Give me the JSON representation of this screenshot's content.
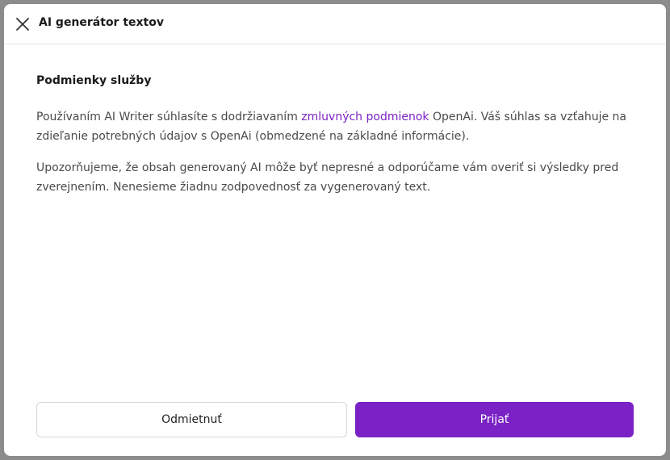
{
  "dialog": {
    "title": "AI generátor textov",
    "close_icon": "close-icon"
  },
  "terms": {
    "heading": "Podmienky služby",
    "paragraph1": {
      "before_link": "Používaním AI Writer súhlasíte s dodržiavaním ",
      "link_text": "zmluvných podmienok",
      "after_link": " OpenAi. Váš súhlas sa vzťahuje na zdieľanie potrebných údajov s OpenAi (obmedzené na základné informácie)."
    },
    "paragraph2": "Upozorňujeme, že obsah generovaný AI môže byť nepresné a odporúčame vám overiť si výsledky pred zverejnením. Nenesieme žiadnu zodpovednosť za vygenerovaný text."
  },
  "actions": {
    "decline_label": "Odmietnuť",
    "accept_label": "Prijať"
  },
  "colors": {
    "accent": "#7a22c5",
    "link": "#7b22c3"
  }
}
